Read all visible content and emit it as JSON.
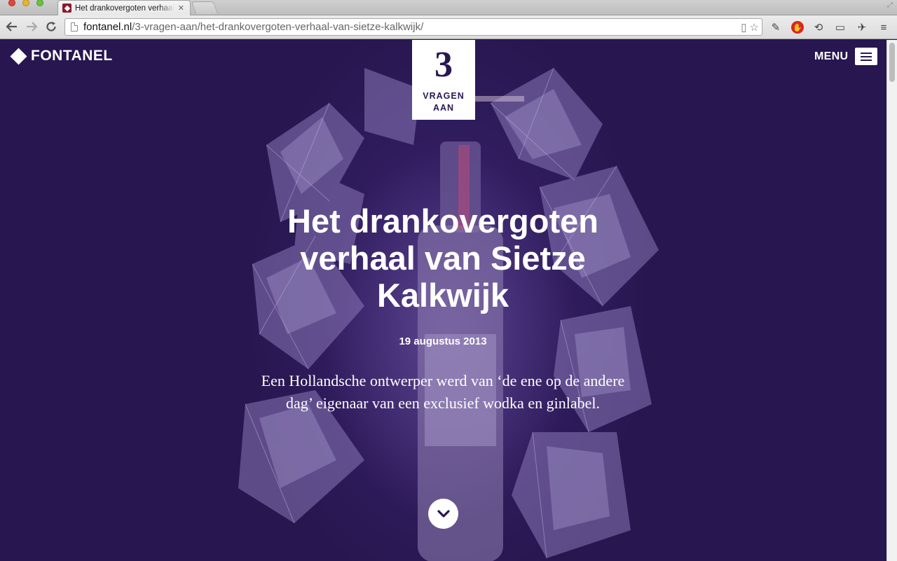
{
  "browser": {
    "tab_title": "Het drankovergoten verhaal",
    "tab_close": "✕",
    "url_host": "fontanel.nl",
    "url_path": "/3-vragen-aan/het-drankovergoten-verhaal-van-sietze-kalkwijk/"
  },
  "site": {
    "logo_text": "FONTANEL",
    "menu_label": "MENU"
  },
  "badge": {
    "number": "3",
    "line1": "VRAGEN",
    "line2": "AAN"
  },
  "article": {
    "title": "Het drankovergoten verhaal van Sietze Kalkwijk",
    "date": "19 augustus 2013",
    "lead": "Een Hollandsche ontwerper werd van ‘de ene op de andere dag’ eigenaar van een exclusief wodka en ginlabel."
  },
  "colors": {
    "page_background": "#2a1850",
    "accent": "#ffffff"
  },
  "icons": [
    "back-arrow-icon",
    "forward-arrow-icon",
    "reload-icon",
    "page-icon",
    "star-icon",
    "menu-icon",
    "chevron-down-icon"
  ]
}
